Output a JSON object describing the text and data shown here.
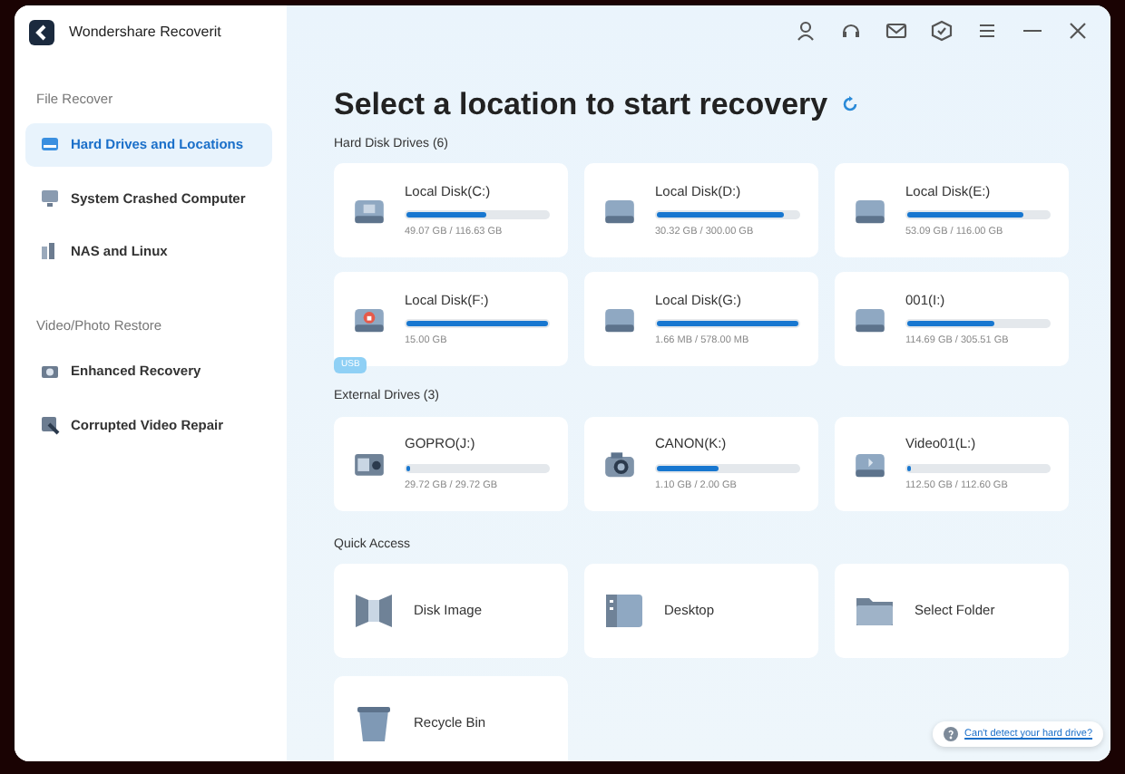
{
  "window": {
    "title": "Wondershare Recoverit"
  },
  "sidebar": {
    "sections": [
      {
        "heading": "File Recover",
        "items": [
          {
            "label": "Hard Drives and Locations",
            "kind": "drives",
            "selected": true
          },
          {
            "label": "System Crashed Computer",
            "kind": "computer",
            "selected": false
          },
          {
            "label": "NAS and Linux",
            "kind": "nas",
            "selected": false
          }
        ]
      },
      {
        "heading": "Video/Photo Restore",
        "items": [
          {
            "label": "Enhanced Recovery",
            "kind": "camera",
            "selected": false
          },
          {
            "label": "Corrupted Video Repair",
            "kind": "repair",
            "selected": false
          }
        ]
      }
    ]
  },
  "main": {
    "title": "Select a location to start recovery",
    "groups": [
      {
        "heading": "Hard Disk Drives (6)",
        "drives": [
          {
            "name": "Local Disk(C:)",
            "kind": "system",
            "level": 0.57,
            "usage": "49.07 GB / 116.63 GB"
          },
          {
            "name": "Local Disk(D:)",
            "kind": "disk",
            "level": 0.9,
            "usage": "30.32 GB / 300.00 GB"
          },
          {
            "name": "Local Disk(E:)",
            "kind": "disk",
            "level": 0.82,
            "usage": "53.09 GB / 116.00 GB"
          },
          {
            "name": "Local Disk(F:)",
            "kind": "usb",
            "level": 1,
            "usage": "15.00 GB",
            "badge": "USB"
          },
          {
            "name": "Local Disk(G:)",
            "kind": "disk",
            "level": 1,
            "usage": "1.66 MB / 578.00 MB"
          },
          {
            "name": "001(I:)",
            "kind": "disk",
            "level": 0.62,
            "usage": "114.69 GB / 305.51 GB"
          }
        ]
      },
      {
        "heading": "External Drives (3)",
        "drives": [
          {
            "name": "GOPRO(J:)",
            "kind": "action-camera",
            "level": 0.02,
            "usage": "29.72 GB / 29.72 GB"
          },
          {
            "name": "CANON(K:)",
            "kind": "camera",
            "level": 0.44,
            "usage": "1.10 GB / 2.00 GB"
          },
          {
            "name": "Video01(L:)",
            "kind": "video-disk",
            "level": 0.02,
            "usage": "112.50 GB / 112.60 GB"
          }
        ]
      }
    ],
    "quick_access": {
      "heading": "Quick Access",
      "items": [
        {
          "label": "Disk Image",
          "kind": "disk-image"
        },
        {
          "label": "Desktop",
          "kind": "desktop"
        },
        {
          "label": "Select Folder",
          "kind": "folder"
        },
        {
          "label": "Recycle Bin",
          "kind": "recycle-bin"
        }
      ]
    },
    "help_link": "Can't detect your hard drive?"
  }
}
